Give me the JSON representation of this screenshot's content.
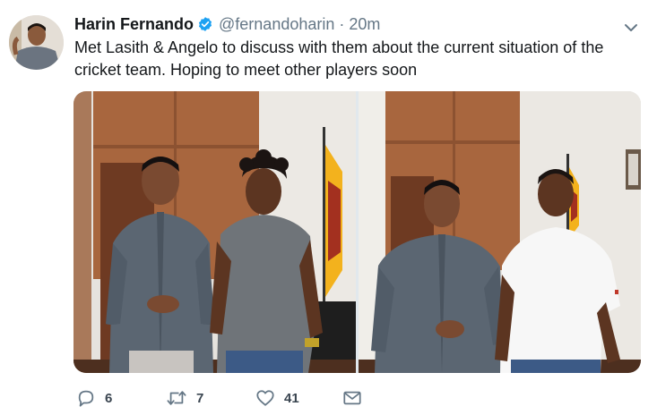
{
  "tweet": {
    "author_name": "Harin Fernando",
    "handle": "@fernandoharin",
    "separator": "·",
    "timestamp": "20m",
    "text": "Met Lasith & Angelo to discuss with them about the current situation of the cricket team. Hoping to meet other players soon"
  },
  "actions": {
    "reply_count": "6",
    "retweet_count": "7",
    "like_count": "41"
  },
  "colors": {
    "verified": "#1da1f2",
    "secondary_text": "#657786",
    "primary_text": "#14171a"
  },
  "icons": [
    "verified-icon",
    "chevron-down-icon",
    "reply-icon",
    "retweet-icon",
    "heart-icon",
    "mail-icon"
  ]
}
